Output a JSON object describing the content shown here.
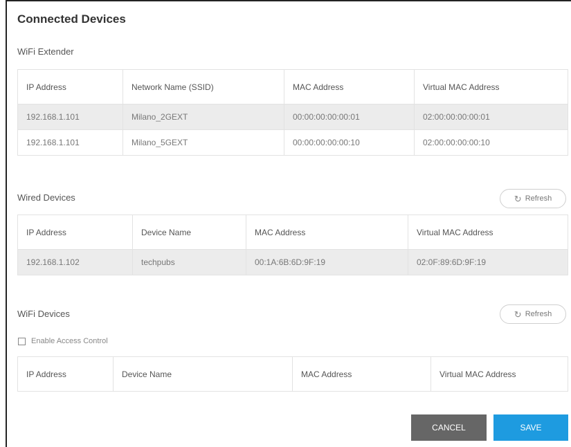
{
  "page": {
    "title": "Connected Devices"
  },
  "wifi_extender": {
    "label": "WiFi Extender",
    "headers": [
      "IP Address",
      "Network Name (SSID)",
      "MAC Address",
      "Virtual MAC Address"
    ],
    "rows": [
      [
        "192.168.1.101",
        "Milano_2GEXT",
        "00:00:00:00:00:01",
        "02:00:00:00:00:01"
      ],
      [
        "192.168.1.101",
        "Milano_5GEXT",
        "00:00:00:00:00:10",
        "02:00:00:00:00:10"
      ]
    ]
  },
  "wired_devices": {
    "label": "Wired Devices",
    "refresh_label": "Refresh",
    "headers": [
      "IP Address",
      "Device Name",
      "MAC Address",
      "Virtual MAC Address"
    ],
    "rows": [
      [
        "192.168.1.102",
        "techpubs",
        "00:1A:6B:6D:9F:19",
        "02:0F:89:6D:9F:19"
      ]
    ]
  },
  "wifi_devices": {
    "label": "WiFi Devices",
    "refresh_label": "Refresh",
    "access_control_label": "Enable Access Control",
    "access_control_checked": false,
    "headers": [
      "IP Address",
      "Device Name",
      "MAC Address",
      "Virtual MAC Address"
    ],
    "rows": []
  },
  "actions": {
    "cancel_label": "CANCEL",
    "save_label": "SAVE"
  },
  "colors": {
    "cancel_bg": "#666666",
    "save_bg": "#1e9be0",
    "row_shade": "#ececec"
  },
  "icons": {
    "refresh": "refresh-icon"
  }
}
